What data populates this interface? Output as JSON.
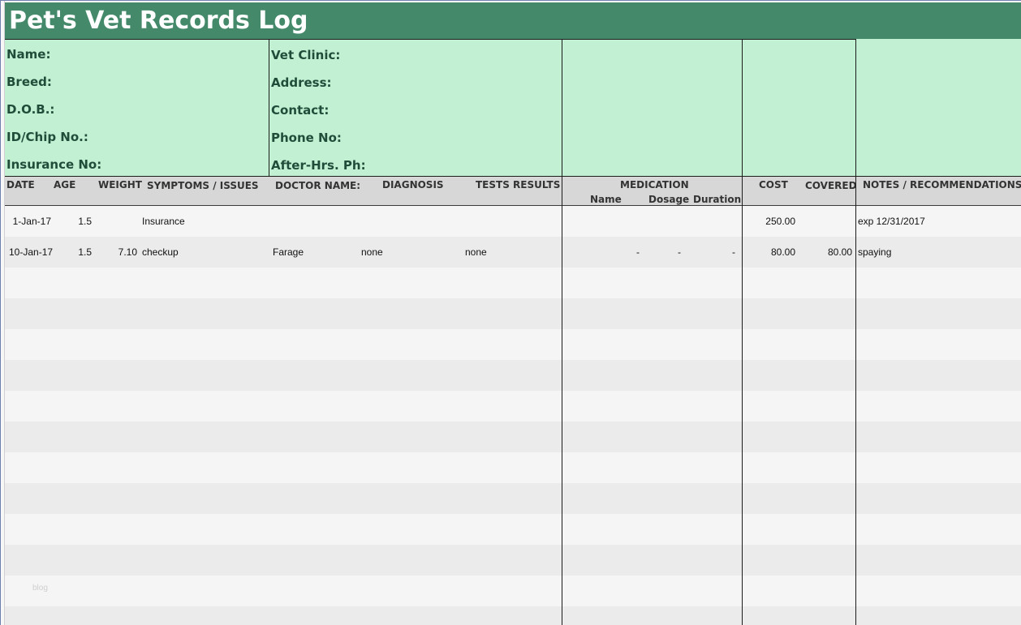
{
  "title": "Pet's Vet Records Log",
  "pet_info": {
    "name_label": "Name:",
    "breed_label": "Breed:",
    "dob_label": "D.O.B.:",
    "id_label": "ID/Chip No.:",
    "insurance_label": "Insurance No:"
  },
  "clinic_info": {
    "clinic_label": "Vet Clinic:",
    "address_label": "Address:",
    "contact_label": "Contact:",
    "phone_label": "Phone No:",
    "after_hours_label": "After-Hrs. Ph:"
  },
  "headers": {
    "date": "DATE",
    "age": "AGE",
    "weight": "WEIGHT",
    "symptoms": "SYMPTOMS / ISSUES",
    "doctor": "DOCTOR NAME:",
    "diagnosis": "DIAGNOSIS",
    "tests": "TESTS RESULTS",
    "medication": "MEDICATION",
    "med_name": "Name",
    "med_dosage": "Dosage",
    "med_duration": "Duration",
    "cost": "COST",
    "covered": "COVERED",
    "notes": "NOTES / RECOMMENDATIONS"
  },
  "records": [
    {
      "date": "1-Jan-17",
      "age": "1.5",
      "weight": "",
      "symptoms": "Insurance",
      "doctor": "",
      "diagnosis": "",
      "tests": "",
      "med_name": "",
      "med_dosage": "",
      "med_duration": "",
      "cost": "250.00",
      "covered": "",
      "notes": "exp 12/31/2017"
    },
    {
      "date": "10-Jan-17",
      "age": "1.5",
      "weight": "7.10",
      "symptoms": "checkup",
      "doctor": "Farage",
      "diagnosis": "none",
      "tests": "none",
      "med_name": "-",
      "med_dosage": "-",
      "med_duration": "-",
      "cost": "80.00",
      "covered": "80.00",
      "notes": "spaying"
    }
  ],
  "watermark": "blog"
}
